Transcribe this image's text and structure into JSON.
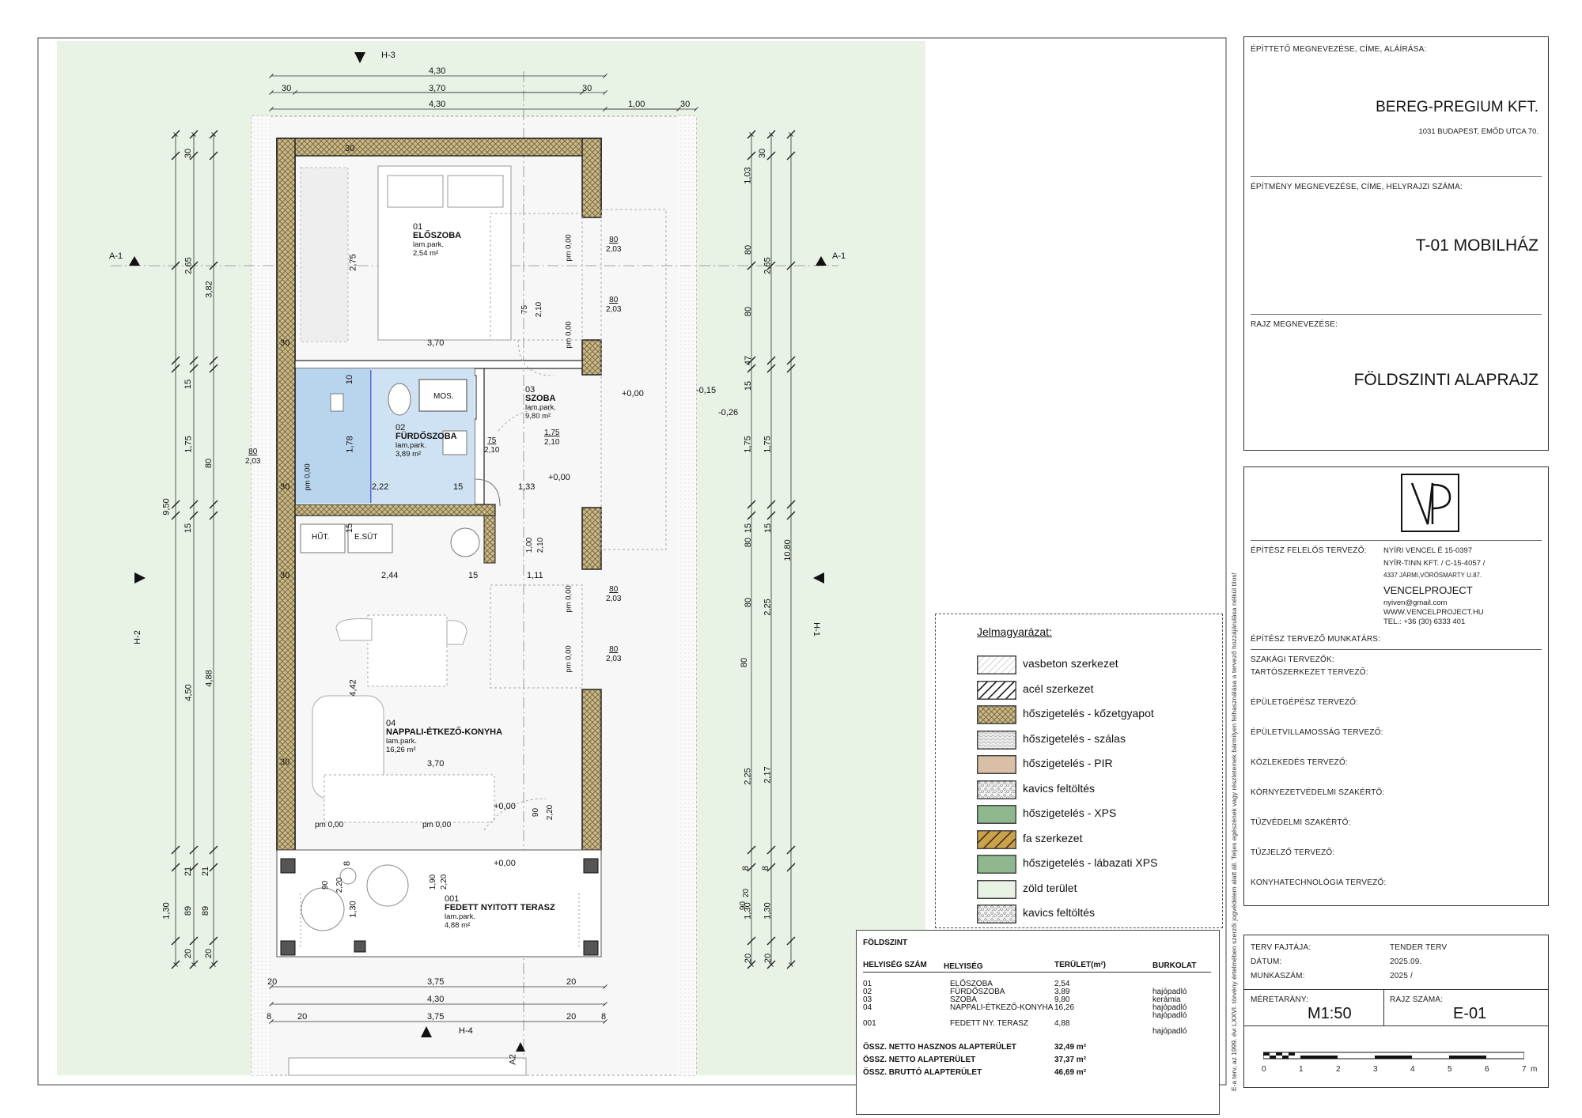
{
  "drawing": {
    "section_marks": {
      "top": "H-3",
      "bottom": "H-4",
      "left": "H-2",
      "right": "H-1",
      "cut_left": "A-1",
      "cut_right": "A-1",
      "cut_bottom": "A2"
    },
    "dims_top": {
      "overall": "4,30",
      "inner": "3,70",
      "wall": "30",
      "side": "1,00",
      "side_wall": "30"
    },
    "dims_bottom": {
      "overall": "4,30",
      "inner": "3,75",
      "edge": "20",
      "edge2": "8"
    },
    "dims_left": {
      "total": "9,50",
      "a": "30",
      "b": "2,65",
      "c": "15",
      "d": "1,75",
      "e": "15",
      "f": "4,50",
      "g": "21",
      "h": "1,30",
      "i": "20",
      "j": "3,82",
      "k": "80",
      "l": "4,88",
      "m": "89",
      "n": "21",
      "o": "89",
      "p": "20"
    },
    "dims_right": {
      "total": "10,80",
      "a": "30",
      "b": "1,03",
      "c": "80",
      "d": "80",
      "e": "47",
      "f": "15",
      "g": "1,75",
      "h": "15",
      "i": "80",
      "j": "80",
      "k": "2,25",
      "l": "80",
      "m": "2,25",
      "n": "8",
      "o": "1,30",
      "p": "20",
      "q": "2,65",
      "r": "1,75",
      "s": "15",
      "t": "2,25",
      "u": "2,17",
      "v": "8",
      "w": "90",
      "x": "20"
    },
    "rooms": [
      {
        "num": "03",
        "name": "SZOBA",
        "floor": "lam.park.",
        "area": "9,80 m²"
      },
      {
        "num": "02",
        "name": "FÜRDŐSZOBA",
        "floor": "lam.park.",
        "area": "3,89 m²"
      },
      {
        "num": "01",
        "name": "ELŐSZOBA",
        "floor": "lam.park.",
        "area": "2,54 m²"
      },
      {
        "num": "04",
        "name": "NAPPALI-ÉTKEZŐ-KONYHA",
        "floor": "lam.park.",
        "area": "16,26 m²"
      },
      {
        "num": "001",
        "name": "FEDETT NYITOTT TERASZ",
        "floor": "lam.park.",
        "area": "4,88 m²"
      }
    ],
    "fixtures": {
      "washer": "MOS.",
      "fridge": "HŰT.",
      "oven": "E.SÜT"
    },
    "levels": {
      "zero": "+0,00",
      "ext1": "-0,15",
      "ext2": "-0,26",
      "pm": "pm 0,00"
    },
    "inner_dims": {
      "room_w": "3,70",
      "bath_w": "2,22",
      "bath_h": "1,78",
      "hall_w": "1,33",
      "kitchen_a": "2,44",
      "kitchen_b": "1,11",
      "living_h": "4,42",
      "room_h": "2,75",
      "terrace_h": "1,30",
      "win_w": "80",
      "win_h": "2,03",
      "door_w": "75",
      "door_h": "2,10",
      "hall_h": "1,75",
      "hall_h2": "2,10",
      "door2_w": "1,00",
      "door3_w": "90",
      "door3_h": "2,20",
      "door4_w": "1,90",
      "door4_h": "2,20",
      "wall15": "15",
      "wall10": "10",
      "wall30": "30",
      "wall8": "8"
    }
  },
  "legend": {
    "title": "Jelmagyarázat:",
    "items": [
      {
        "label": "vasbeton szerkezet",
        "pattern": "hatch-thin"
      },
      {
        "label": "acél szerkezet",
        "pattern": "hatch-bold"
      },
      {
        "label": "hőszigetelés - kőzetgyapot",
        "pattern": "rockwool"
      },
      {
        "label": "hőszigetelés - szálas",
        "pattern": "fiber"
      },
      {
        "label": "hőszigetelés - PIR",
        "pattern": "pir"
      },
      {
        "label": "kavics feltöltés",
        "pattern": "gravel"
      },
      {
        "label": "hőszigetelés - XPS",
        "pattern": "xps"
      },
      {
        "label": "fa szerkezet",
        "pattern": "wood"
      },
      {
        "label": "hőszigetelés - lábazati XPS",
        "pattern": "xps"
      },
      {
        "label": "zöld terület",
        "pattern": "green"
      },
      {
        "label": "kavics feltöltés",
        "pattern": "gravel2"
      }
    ]
  },
  "room_table": {
    "title": "FÖLDSZINT",
    "headers": {
      "num": "HELYISÉG SZÁM",
      "name": "HELYISÉG",
      "area": "TERÜLET(m²)",
      "floor": "BURKOLAT"
    },
    "rows": [
      {
        "num": "01",
        "name": "ELŐSZOBA",
        "area": "2,54",
        "floor": "hajópadló"
      },
      {
        "num": "02",
        "name": "FÜRDŐSZOBA",
        "area": "3,89",
        "floor": "kerámia"
      },
      {
        "num": "03",
        "name": "SZOBA",
        "area": "9,80",
        "floor": "hajópadló"
      },
      {
        "num": "04",
        "name": "NAPPALI-ÉTKEZŐ-KONYHA",
        "area": "16,26",
        "floor": "hajópadló"
      },
      {
        "num": "001",
        "name": "FEDETT NY. TERASZ",
        "area": "4,88",
        "floor": "hajópadló"
      }
    ],
    "totals": [
      {
        "label": "ÖSSZ. NETTO HASZNOS ALAPTERÜLET",
        "value": "32,49 m²"
      },
      {
        "label": "ÖSSZ. NETTO ALAPTERÜLET",
        "value": "37,37 m²"
      },
      {
        "label": "ÖSSZ. BRUTTÓ ALAPTERÜLET",
        "value": "46,69 m²"
      }
    ]
  },
  "title_block": {
    "client_label": "ÉPÍTTETŐ MEGNEVEZÉSE, CÍME, ALÁÍRÁSA:",
    "client_name": "BEREG-PREGIUM KFT.",
    "client_address": "1031 BUDAPEST, EMŐD UTCA 70.",
    "building_label": "ÉPÍTMÉNY MEGNEVEZÉSE, CÍME, HELYRAJZI SZÁMA:",
    "building_name": "T-01 MOBILHÁZ",
    "drawing_label": "RAJZ MEGNEVEZÉSE:",
    "drawing_name": "FÖLDSZINTI ALAPRAJZ",
    "logo_text": "VP",
    "architect_label": "ÉPÍTÉSZ FELELŐS TERVEZŐ:",
    "architect_lines": [
      "NYÍRI VENCEL É 15-0397",
      "NYÍR-TINN KFT. / C-15-4057 /",
      "4337 JÁRMI,VÖRÖSMARTY U.87."
    ],
    "studio": "VENCELPROJECT",
    "studio_lines": [
      "nyiven@gmail.com",
      "WWW.VENCELPROJECT.HU",
      "TEL.: +36 (30) 6333 401"
    ],
    "assistant_label": "ÉPÍTÉSZ TERVEZŐ MUNKATÁRS:",
    "specialists_label": "SZAKÁGI TERVEZŐK:",
    "specialists": [
      "TARTÓSZERKEZET TERVEZŐ:",
      "ÉPÜLETGÉPÉSZ TERVEZŐ:",
      "ÉPÜLETVILLAMOSSÁG TERVEZŐ:",
      "KÖZLEKEDÉS TERVEZŐ:",
      "KÖRNYEZETVÉDELMI SZAKÉRTŐ:",
      "TŰZVÉDELMI SZAKÉRTŐ:",
      "TŰZJELZŐ TERVEZŐ:",
      "KONYHATECHNOLÓGIA TERVEZŐ:"
    ],
    "plan_type_label": "TERV FAJTÁJA:",
    "plan_type": "TENDER TERV",
    "date_label": "DÁTUM:",
    "date": "2025.09.",
    "job_label": "MUNKASZÁM:",
    "job": "2025 /",
    "scale_label": "MÉRETARÁNY:",
    "scale": "M1:50",
    "sheet_label": "RAJZ SZÁMA:",
    "sheet": "E-01",
    "scale_ticks": [
      "0",
      "1",
      "2",
      "3",
      "4",
      "5",
      "6",
      "7"
    ],
    "scale_unit": "m",
    "copyright": "E-a terv, az 1999. évi LXXVI. törvény értelmében szerzői jogvédelem alatt áll. Teljes egészének vagy részleteinek bármilyen felhasználása a tervező hozzájárulása nélkül tilos!"
  },
  "colors": {
    "green_area": "#e8f3e6",
    "bath_fill": "#cfe2f3",
    "insulation": "#b9a97a",
    "line": "#222"
  }
}
